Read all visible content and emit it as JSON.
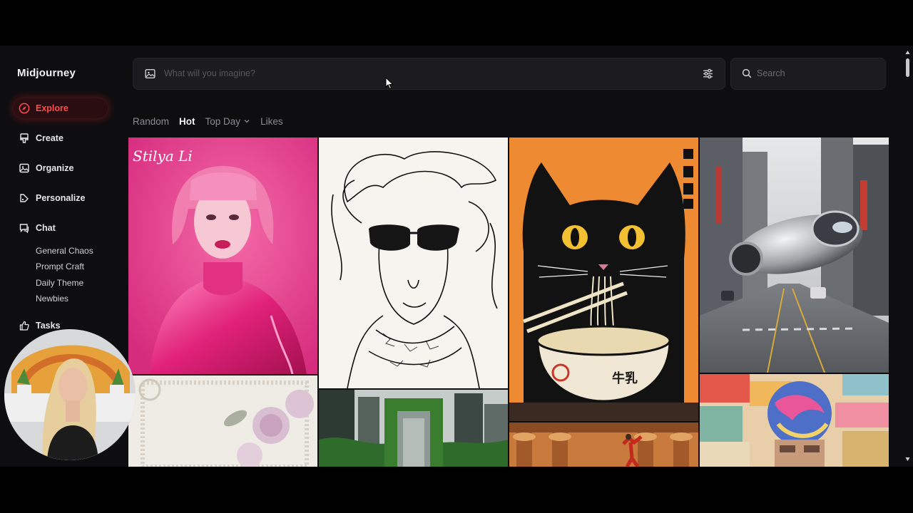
{
  "app": {
    "title": "Midjourney"
  },
  "sidebar": {
    "items": [
      {
        "label": "Explore",
        "icon": "compass-icon",
        "active": true
      },
      {
        "label": "Create",
        "icon": "brush-icon"
      },
      {
        "label": "Organize",
        "icon": "image-icon"
      },
      {
        "label": "Personalize",
        "icon": "palette-icon"
      },
      {
        "label": "Chat",
        "icon": "chat-icon"
      },
      {
        "label": "Tasks",
        "icon": "thumbs-up-icon"
      }
    ],
    "chat_rooms": [
      "General Chaos",
      "Prompt Craft",
      "Daily Theme",
      "Newbies"
    ]
  },
  "prompt": {
    "placeholder": "What will you imagine?",
    "image_icon": "image-icon",
    "settings_icon": "sliders-icon"
  },
  "search": {
    "placeholder": "Search"
  },
  "tabs": [
    {
      "label": "Random"
    },
    {
      "label": "Hot",
      "active": true
    },
    {
      "label": "Top Day",
      "dropdown": true
    },
    {
      "label": "Likes"
    }
  ],
  "gallery": {
    "tiles": [
      {
        "name": "pink-portrait",
        "signature": "Stilya Li"
      },
      {
        "name": "sketch-woman"
      },
      {
        "name": "cat-ramen",
        "seal_text": "牛乳"
      },
      {
        "name": "hover-bike-city"
      },
      {
        "name": "lace-roses"
      },
      {
        "name": "forest-portal"
      },
      {
        "name": "ancient-temple"
      },
      {
        "name": "collage-head"
      }
    ]
  },
  "colors": {
    "accent": "#ff4d4d",
    "background": "#0e0e10",
    "panel": "#1c1c20"
  }
}
